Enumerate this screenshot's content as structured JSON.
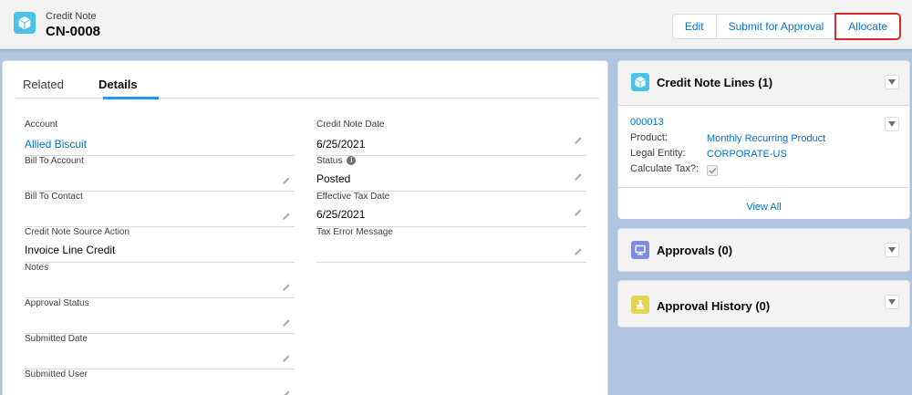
{
  "header": {
    "object_type": "Credit Note",
    "record_name": "CN-0008",
    "icon": "cube-icon",
    "buttons": [
      "Edit",
      "Submit for Approval",
      "Allocate"
    ]
  },
  "tabs": [
    "Related",
    "Details"
  ],
  "active_tab": "Details",
  "left_fields": [
    {
      "label": "Account",
      "value": "Allied Biscuit",
      "link": true
    },
    {
      "label": "Bill To Account",
      "value": ""
    },
    {
      "label": "Bill To Contact",
      "value": ""
    },
    {
      "label": "Credit Note Source Action",
      "value": "Invoice Line Credit"
    },
    {
      "label": "Notes",
      "value": ""
    },
    {
      "label": "Approval Status",
      "value": ""
    },
    {
      "label": "Submitted Date",
      "value": ""
    },
    {
      "label": "Submitted User",
      "value": ""
    }
  ],
  "right_fields": [
    {
      "label": "Credit Note Date",
      "value": "6/25/2021"
    },
    {
      "label": "Status",
      "value": "Posted",
      "info": "i"
    },
    {
      "label": "Effective Tax Date",
      "value": "6/25/2021"
    },
    {
      "label": "Tax Error Message",
      "value": ""
    }
  ],
  "credit_note_lines": {
    "title": "Credit Note Lines (1)",
    "record_link": "000013",
    "product_label": "Product:",
    "product_value": "Monthly Recurring Product",
    "legal_entity_label": "Legal Entity:",
    "legal_entity_value": "CORPORATE-US",
    "calculate_tax_label": "Calculate Tax?:",
    "calculate_tax_checked": true,
    "view_all": "View All"
  },
  "approvals": {
    "title": "Approvals (0)"
  },
  "approval_history": {
    "title": "Approval History (0)"
  },
  "colors": {
    "brand_link": "#0070d2",
    "header_icon": "#4bc3e8",
    "approvals_icon": "#7f8de1",
    "history_icon": "#e3d553",
    "highlight_border": "#d9272e"
  }
}
